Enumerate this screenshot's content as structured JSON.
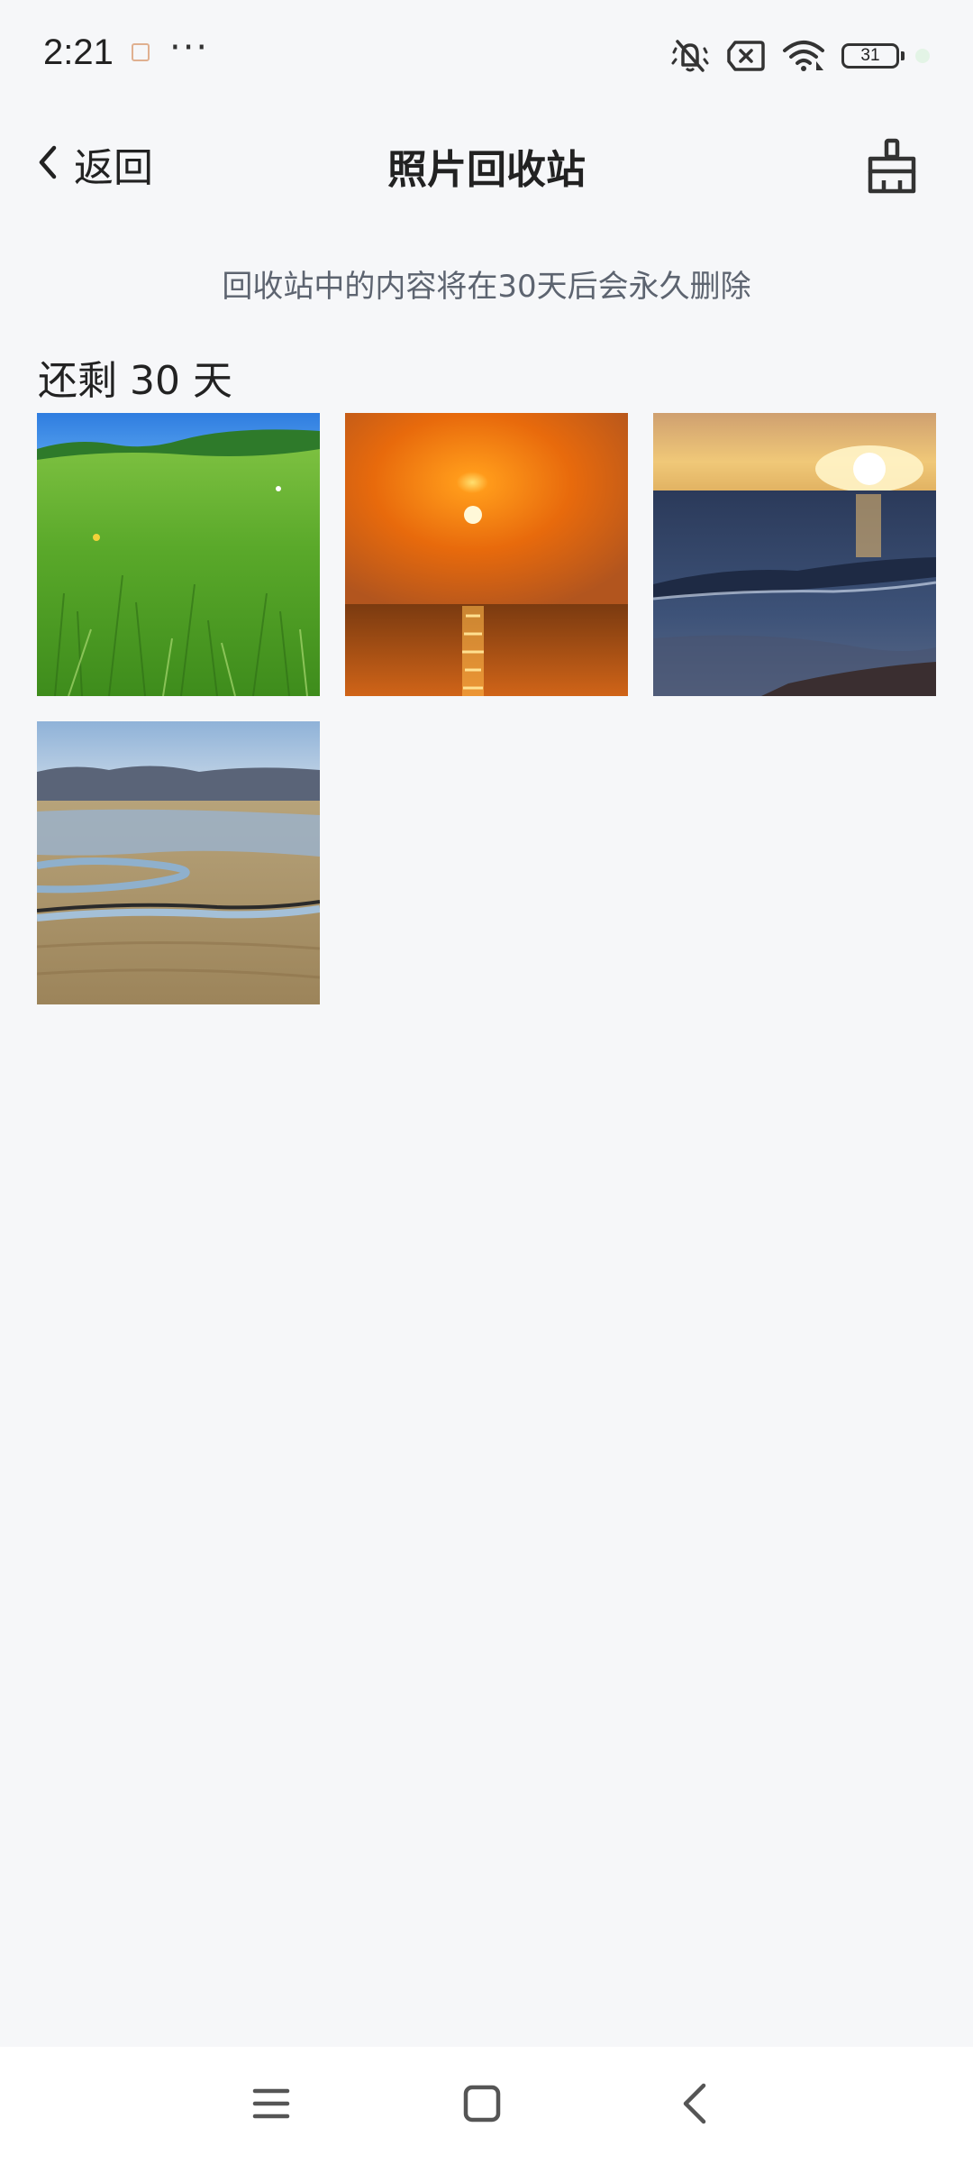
{
  "status_bar": {
    "time": "2:21",
    "dots": "···",
    "battery_level": "31",
    "icons": [
      "notification-app-icon",
      "mute-vibrate-icon",
      "sim-error-icon",
      "wifi-icon",
      "battery-icon"
    ]
  },
  "header": {
    "back_label": "返回",
    "title": "照片回收站",
    "clean_icon": "broom-icon"
  },
  "notice": "回收站中的内容将在30天后会永久删除",
  "section": {
    "title": "还剩 30 天"
  },
  "photos": [
    {
      "name": "grassland-photo"
    },
    {
      "name": "sunset-sea-photo"
    },
    {
      "name": "beach-sunset-photo"
    },
    {
      "name": "river-wetland-photo"
    }
  ],
  "nav_bar": {
    "icons": [
      "menu-icon",
      "home-icon",
      "back-icon"
    ]
  },
  "colors": {
    "background": "#f6f7f9",
    "text": "#222222",
    "notice_text": "#5d6470",
    "nav_background": "#ffffff"
  }
}
